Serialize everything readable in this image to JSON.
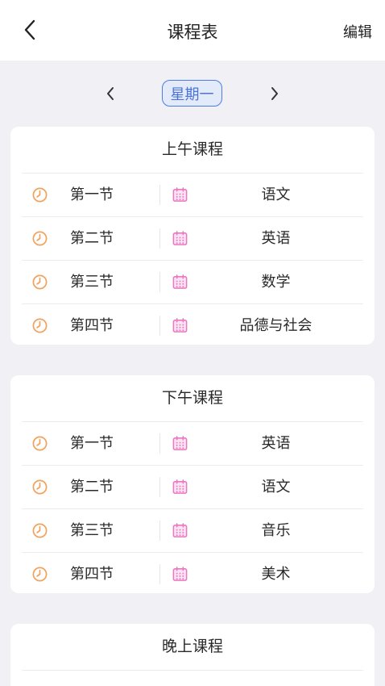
{
  "header": {
    "title": "课程表",
    "edit_label": "编辑"
  },
  "day_switcher": {
    "current_day": "星期一"
  },
  "sections": [
    {
      "title": "上午课程",
      "rows": [
        {
          "period": "第一节",
          "subject": "语文"
        },
        {
          "period": "第二节",
          "subject": "英语"
        },
        {
          "period": "第三节",
          "subject": "数学"
        },
        {
          "period": "第四节",
          "subject": "品德与社会"
        }
      ]
    },
    {
      "title": "下午课程",
      "rows": [
        {
          "period": "第一节",
          "subject": "英语"
        },
        {
          "period": "第二节",
          "subject": "语文"
        },
        {
          "period": "第三节",
          "subject": "音乐"
        },
        {
          "period": "第四节",
          "subject": "美术"
        }
      ]
    },
    {
      "title": "晚上课程",
      "rows": []
    }
  ],
  "colors": {
    "clock_icon": "#F0A35E",
    "calendar_icon": "#E879C3",
    "day_accent": "#4F7BE3"
  },
  "icons": {
    "back": "chevron-left-icon",
    "prev_day": "chevron-left-icon",
    "next_day": "chevron-right-icon",
    "period": "clock-icon",
    "subject": "calendar-icon"
  }
}
